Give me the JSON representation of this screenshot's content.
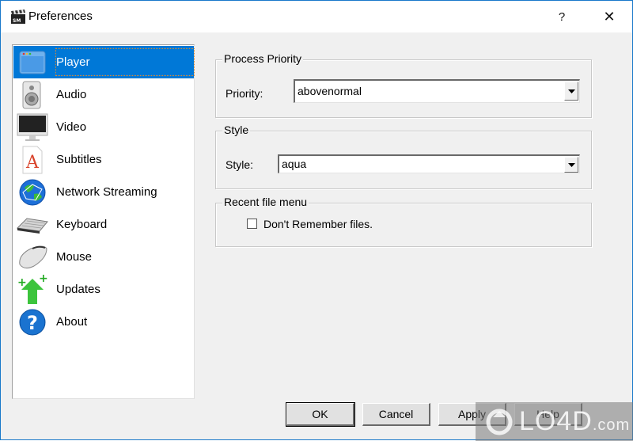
{
  "window": {
    "title": "Preferences",
    "help_button": "?",
    "close_button": "✕"
  },
  "sidebar": {
    "items": [
      {
        "label": "Player",
        "icon": "window-icon",
        "selected": true
      },
      {
        "label": "Audio",
        "icon": "speaker-icon",
        "selected": false
      },
      {
        "label": "Video",
        "icon": "monitor-icon",
        "selected": false
      },
      {
        "label": "Subtitles",
        "icon": "font-document-icon",
        "selected": false
      },
      {
        "label": "Network Streaming",
        "icon": "globe-icon",
        "selected": false
      },
      {
        "label": "Keyboard",
        "icon": "keyboard-icon",
        "selected": false
      },
      {
        "label": "Mouse",
        "icon": "mouse-icon",
        "selected": false
      },
      {
        "label": "Updates",
        "icon": "update-arrow-icon",
        "selected": false
      },
      {
        "label": "About",
        "icon": "help-circle-icon",
        "selected": false
      }
    ]
  },
  "groups": {
    "priority": {
      "title": "Process Priority",
      "label": "Priority:",
      "value": "abovenormal"
    },
    "style": {
      "title": "Style",
      "label": "Style:",
      "value": "aqua"
    },
    "recent": {
      "title": "Recent file menu",
      "checkbox_label": "Don't Remember files.",
      "checked": false
    }
  },
  "buttons": {
    "ok": "OK",
    "cancel": "Cancel",
    "apply": "Apply",
    "help": "Help"
  },
  "watermark": {
    "text": "LO4D",
    "suffix": ".com"
  },
  "colors": {
    "accent": "#0078d7",
    "window_border": "#1979ca",
    "background": "#f0f0f0"
  }
}
